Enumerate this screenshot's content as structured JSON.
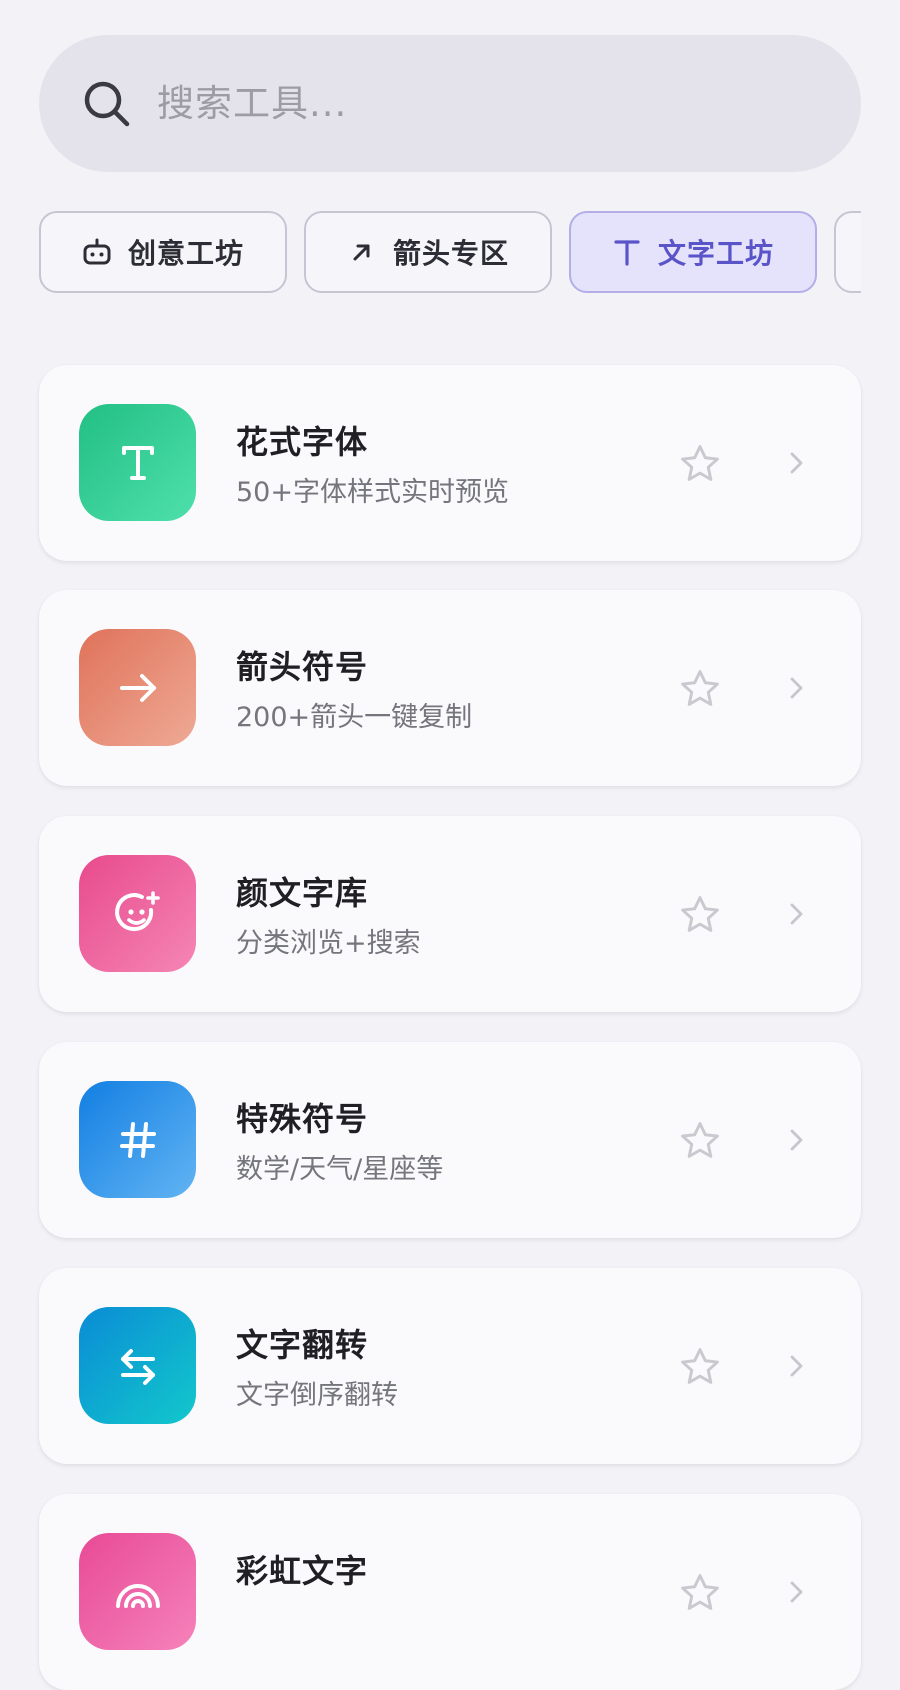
{
  "search": {
    "placeholder": "搜索工具..."
  },
  "chips": [
    {
      "label": "创意工坊",
      "icon": "robot-icon",
      "active": false
    },
    {
      "label": "箭头专区",
      "icon": "arrow-up-right-icon",
      "active": false
    },
    {
      "label": "文字工坊",
      "icon": "text-t-icon",
      "active": true
    }
  ],
  "tools": [
    {
      "title": "花式字体",
      "desc": "50+字体样式实时预览",
      "icon": "text-t-icon",
      "gradient": [
        "#2ac38a",
        "#49deaa"
      ]
    },
    {
      "title": "箭头符号",
      "desc": "200+箭头一键复制",
      "icon": "arrow-right-icon",
      "gradient": [
        "#e27c63",
        "#eaa58f"
      ]
    },
    {
      "title": "颜文字库",
      "desc": "分类浏览+搜索",
      "icon": "smiley-plus-icon",
      "gradient": [
        "#e94f90",
        "#f37cad"
      ]
    },
    {
      "title": "特殊符号",
      "desc": "数学/天气/星座等",
      "icon": "hash-icon",
      "gradient": [
        "#1b86e6",
        "#5aaef1"
      ]
    },
    {
      "title": "文字翻转",
      "desc": "文字倒序翻转",
      "icon": "swap-arrows-icon",
      "gradient": [
        "#0b91d4",
        "#11c2cd"
      ]
    },
    {
      "title": "彩虹文字",
      "desc": "",
      "icon": "rainbow-icon",
      "gradient": [
        "#e9509c",
        "#f27cb6"
      ]
    }
  ],
  "colors": {
    "background": "#f2f2f7",
    "accent": "#5a54c9",
    "star": "#c9c9cf",
    "chevron": "#c6c6cc"
  }
}
